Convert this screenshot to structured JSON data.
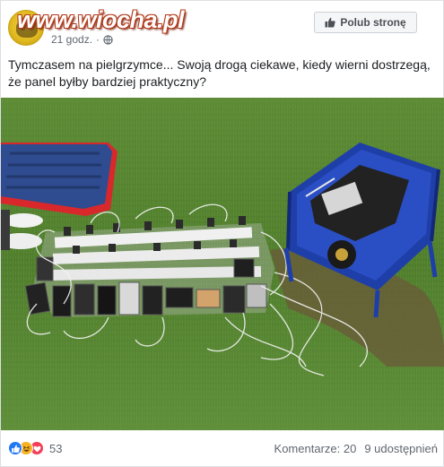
{
  "header": {
    "page_name": "",
    "watermark": "www.wiocha.pl",
    "time": "21 godz.",
    "separator": "·",
    "privacy_icon": "globe-icon",
    "like_page_label": "Polub stronę"
  },
  "post": {
    "text": "Tymczasem na pielgrzymce... Swoją drogą ciekawe, kiedy wierni dostrzegą, że panel byłby bardziej praktyczny?"
  },
  "footer": {
    "reactions": [
      "like",
      "haha",
      "love"
    ],
    "reaction_count": "53",
    "comments": "Komentarze: 20",
    "shares": "9 udostępnień"
  },
  "colors": {
    "link": "#385898",
    "like": "#2078f4",
    "haha": "#f7b125",
    "love": "#f33e58",
    "generator": "#1f3fa8",
    "mattress": "#d8282c"
  }
}
